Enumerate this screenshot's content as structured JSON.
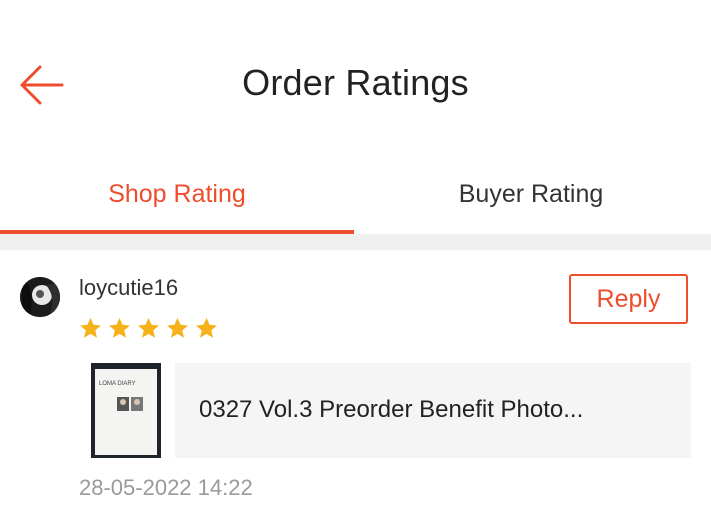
{
  "header": {
    "title": "Order Ratings",
    "back_icon": "arrow-left-icon",
    "accent_color": "#ee4d2d"
  },
  "tabs": [
    {
      "label": "Shop Rating",
      "active": true
    },
    {
      "label": "Buyer Rating",
      "active": false
    }
  ],
  "review": {
    "username": "loycutie16",
    "avatar_icon": "user-avatar",
    "rating": 5,
    "rating_max": 5,
    "star_color": "#f6b21b",
    "reply_label": "Reply",
    "product_name": "0327 Vol.3 Preorder Benefit Photo...",
    "product_thumb_text": "LOMA DIARY",
    "timestamp": "28-05-2022 14:22"
  }
}
